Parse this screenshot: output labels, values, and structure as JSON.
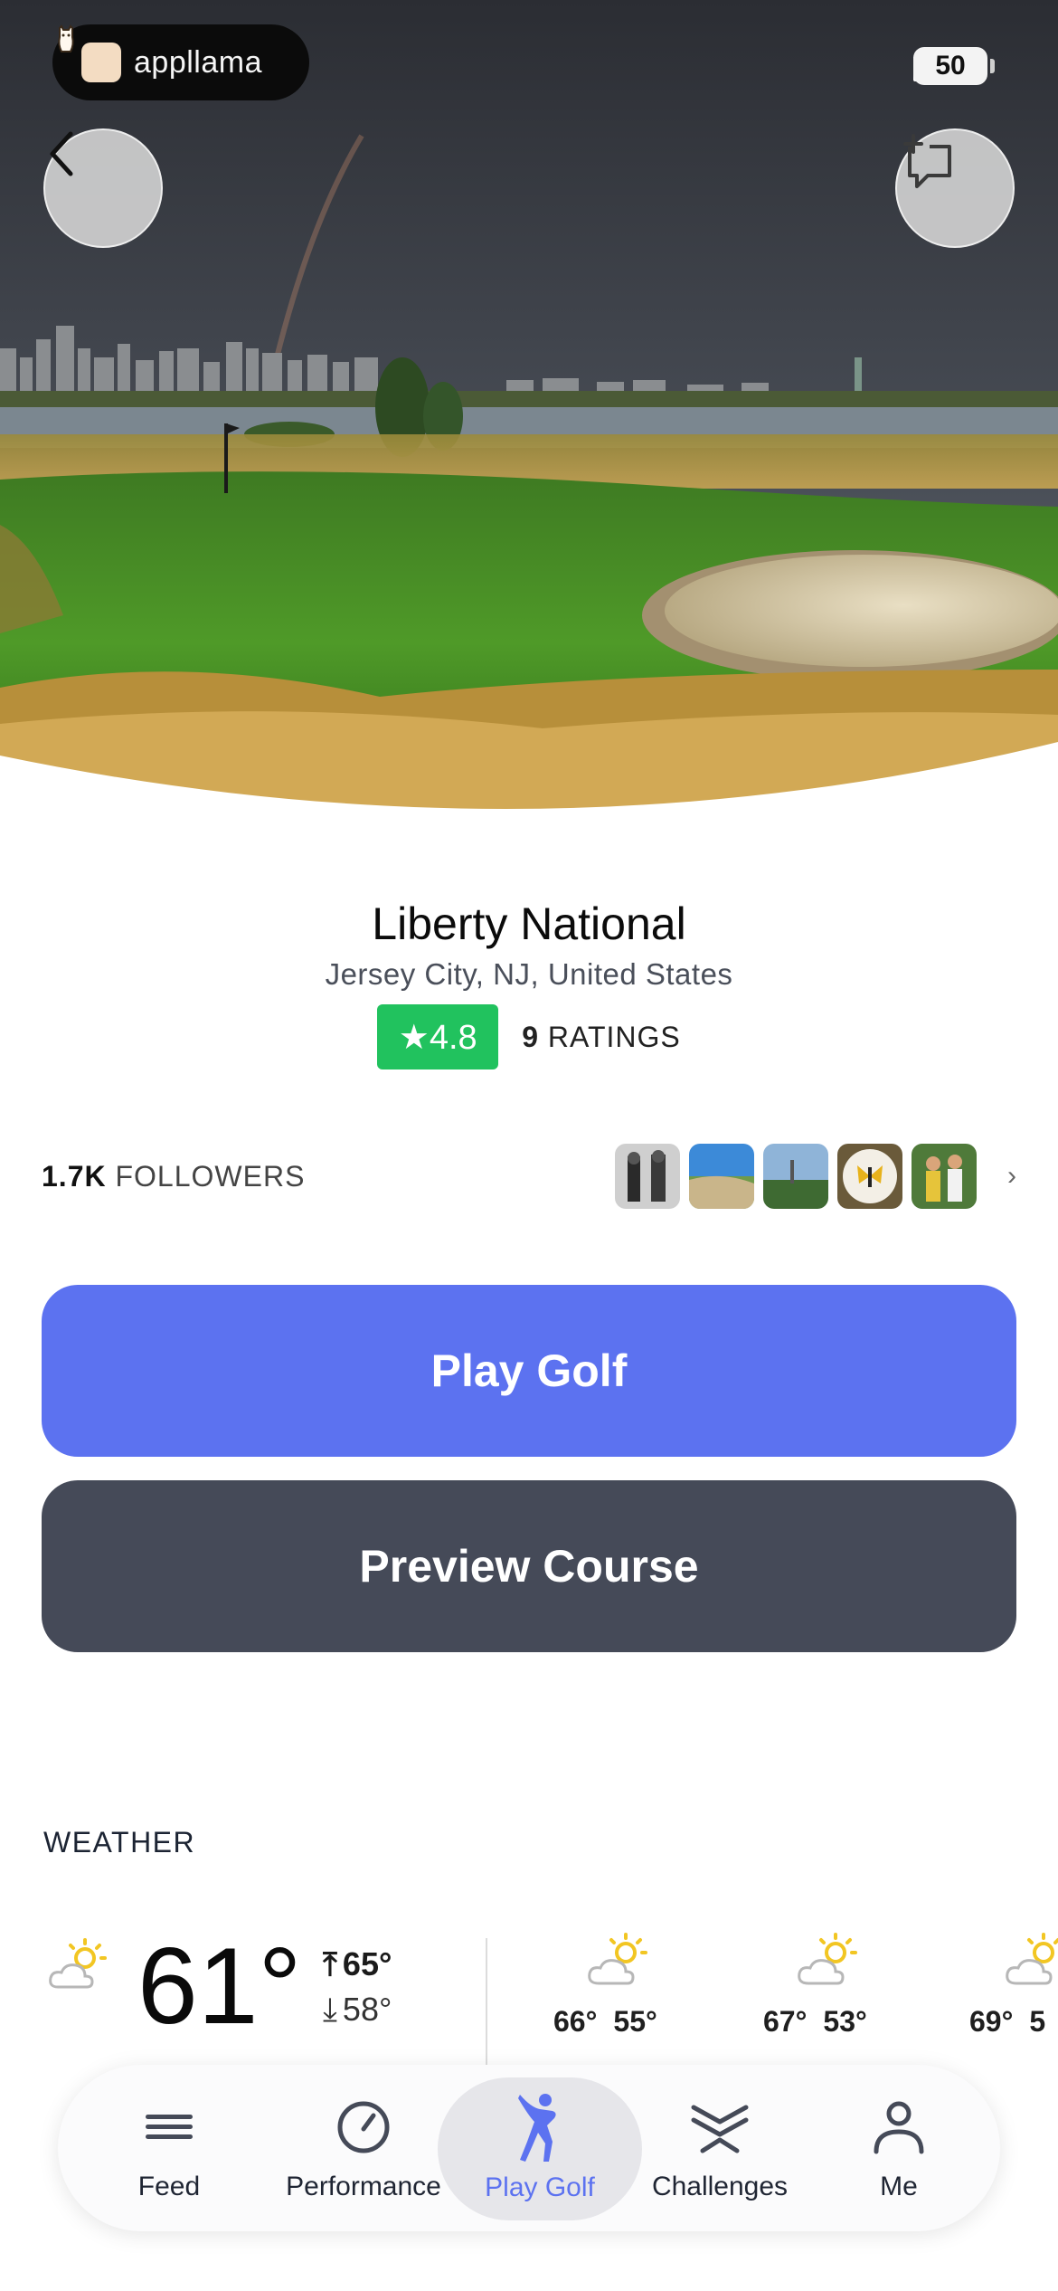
{
  "status_bar": {
    "app_name": "appllama",
    "battery": "50"
  },
  "header": {
    "back_icon": "chevron-left-icon",
    "add_icon": "add-comment-icon"
  },
  "course": {
    "name": "Liberty National",
    "location": "Jersey City, NJ, United States",
    "rating": "★4.8",
    "ratings_count": "9",
    "ratings_label": "RATINGS"
  },
  "followers": {
    "count": "1.7K",
    "label": "FOLLOWERS"
  },
  "actions": {
    "play_golf": "Play Golf",
    "preview_course": "Preview Course"
  },
  "weather": {
    "heading": "WEATHER",
    "current": {
      "temp": "61°",
      "high": "65°",
      "low": "58°",
      "icon": "partly-sunny-icon"
    },
    "forecast": [
      {
        "high": "66°",
        "low": "55°",
        "icon": "partly-sunny-icon"
      },
      {
        "high": "67°",
        "low": "53°",
        "icon": "partly-sunny-icon"
      },
      {
        "high": "69°",
        "low": "5",
        "icon": "partly-sunny-icon"
      }
    ]
  },
  "tabs": [
    {
      "label": "Feed",
      "icon": "menu-icon"
    },
    {
      "label": "Performance",
      "icon": "gauge-icon"
    },
    {
      "label": "Play Golf",
      "icon": "golfer-icon",
      "active": true
    },
    {
      "label": "Challenges",
      "icon": "chevrons-icon"
    },
    {
      "label": "Me",
      "icon": "person-icon"
    }
  ],
  "colors": {
    "accent": "#5c72f0",
    "secondary_button": "#454a58",
    "rating_green": "#21c25e"
  }
}
